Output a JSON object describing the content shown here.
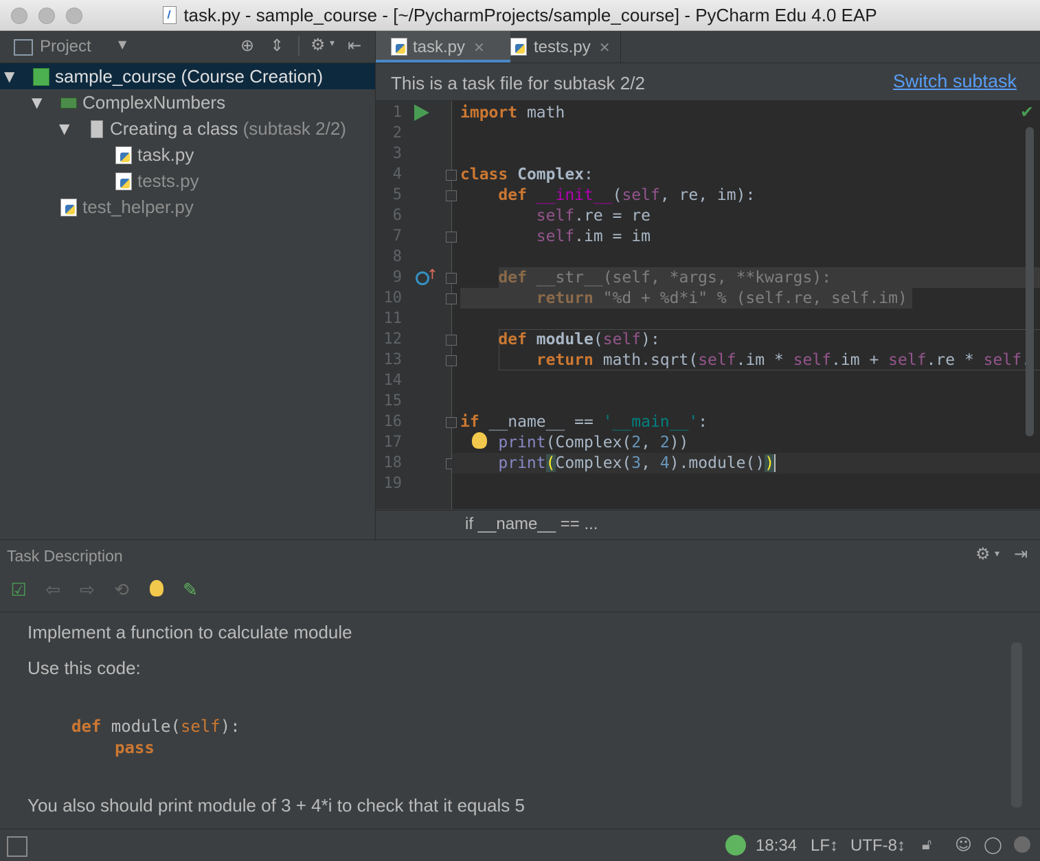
{
  "window": {
    "title": "task.py - sample_course - [~/PycharmProjects/sample_course] - PyCharm Edu 4.0 EAP"
  },
  "project_panel": {
    "title": "Project",
    "tree": [
      {
        "label": "sample_course",
        "suffix": " (Course Creation)",
        "icon": "course-folder-icon"
      },
      {
        "label": "ComplexNumbers",
        "suffix": "",
        "icon": "lesson-icon"
      },
      {
        "label": "Creating a class",
        "suffix": " (subtask 2/2)",
        "icon": "task-icon"
      },
      {
        "label": "task.py",
        "suffix": "",
        "icon": "python-file-icon"
      },
      {
        "label": "tests.py",
        "suffix": "",
        "icon": "python-file-icon"
      },
      {
        "label": "test_helper.py",
        "suffix": "",
        "icon": "python-file-icon"
      }
    ]
  },
  "editor": {
    "tabs": [
      {
        "label": "task.py",
        "active": true
      },
      {
        "label": "tests.py",
        "active": false
      }
    ],
    "banner_text": "This is a task file for subtask 2/2",
    "switch_link": "Switch subtask",
    "line_numbers": [
      "1",
      "2",
      "3",
      "4",
      "5",
      "6",
      "7",
      "8",
      "9",
      "10",
      "11",
      "12",
      "13",
      "14",
      "15",
      "16",
      "17",
      "18",
      "19"
    ],
    "breadcrumb": "if __name__ == ..."
  },
  "task_description": {
    "title": "Task Description",
    "line1": "Implement a function to calculate module",
    "line2": "Use this code:",
    "code_def": "def",
    "code_sig": " module(",
    "code_self": "self",
    "code_end": "):",
    "code_pass": "pass",
    "line3": "You also should print module of 3 + 4*i to check that it equals 5"
  },
  "status_bar": {
    "position": "18:34",
    "line_sep": "LF↕",
    "encoding": "UTF-8↕"
  },
  "colors": {
    "accent": "#4a88c7",
    "keyword": "#cc7832",
    "self": "#94558d",
    "string": "#008080",
    "number": "#6897bb"
  }
}
